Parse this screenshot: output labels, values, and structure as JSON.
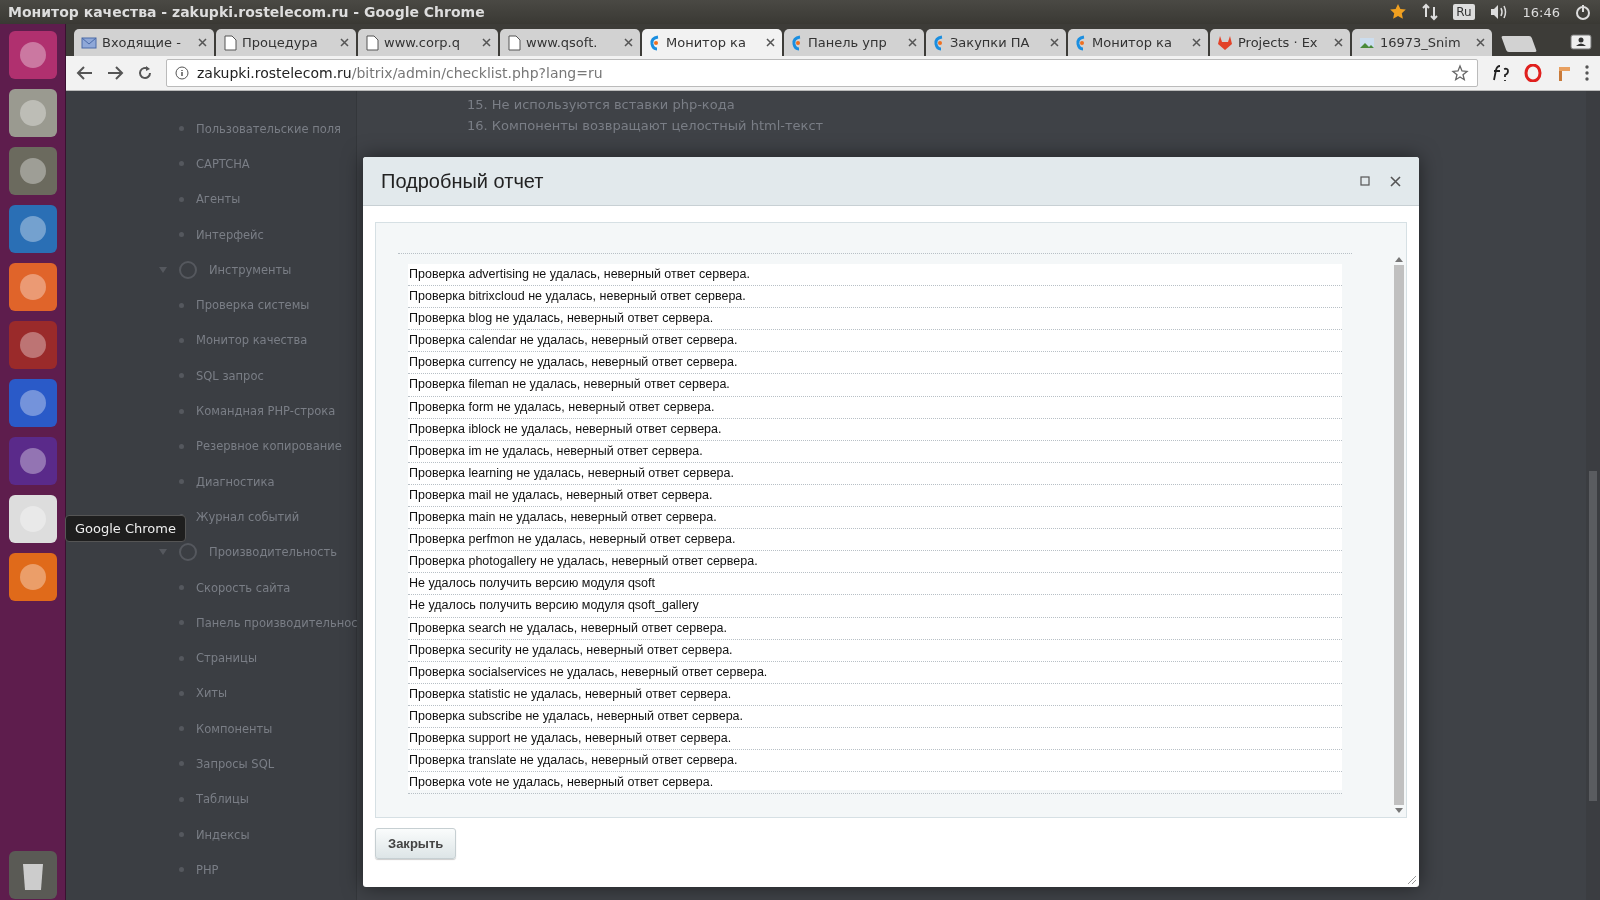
{
  "top_bar": {
    "title": "Монитор качества - zakupki.rostelecom.ru - Google Chrome",
    "keyboard": "Ru",
    "time": "16:46"
  },
  "tooltip": "Google Chrome",
  "tabs": [
    {
      "label": "Входящие -",
      "kind": "mail",
      "selected": false
    },
    {
      "label": "Процедура",
      "kind": "page",
      "selected": false
    },
    {
      "label": "www.corp.q",
      "kind": "page",
      "selected": false
    },
    {
      "label": "www.qsoft.",
      "kind": "page",
      "selected": false
    },
    {
      "label": "Монитор ка",
      "kind": "logo",
      "selected": true
    },
    {
      "label": "Панель упр",
      "kind": "logo",
      "selected": false
    },
    {
      "label": "Закупки ПА",
      "kind": "logo",
      "selected": false
    },
    {
      "label": "Монитор ка",
      "kind": "logo",
      "selected": false
    },
    {
      "label": "Projects · Ex",
      "kind": "fox",
      "selected": false
    },
    {
      "label": "16973_Snim",
      "kind": "image",
      "selected": false
    }
  ],
  "address": {
    "host": "zakupki.rostelecom.ru",
    "path": "/bitrix/admin/checklist.php?lang=ru"
  },
  "background_menu": [
    {
      "label": "Пользовательские поля",
      "kind": "item"
    },
    {
      "label": "CAPTCHA",
      "kind": "item"
    },
    {
      "label": "Агенты",
      "kind": "item"
    },
    {
      "label": "Интерфейс",
      "kind": "item"
    },
    {
      "label": "Инструменты",
      "kind": "section"
    },
    {
      "label": "Проверка системы",
      "kind": "item"
    },
    {
      "label": "Монитор качества",
      "kind": "item"
    },
    {
      "label": "SQL запрос",
      "kind": "item"
    },
    {
      "label": "Командная PHP-строка",
      "kind": "item"
    },
    {
      "label": "Резервное копирование",
      "kind": "item"
    },
    {
      "label": "Диагностика",
      "kind": "item"
    },
    {
      "label": "Журнал событий",
      "kind": "item"
    },
    {
      "label": "Производительность",
      "kind": "section"
    },
    {
      "label": "Скорость сайта",
      "kind": "item"
    },
    {
      "label": "Панель производительнос",
      "kind": "item"
    },
    {
      "label": "Страницы",
      "kind": "item"
    },
    {
      "label": "Хиты",
      "kind": "item"
    },
    {
      "label": "Компоненты",
      "kind": "item"
    },
    {
      "label": "Запросы SQL",
      "kind": "item"
    },
    {
      "label": "Таблицы",
      "kind": "item"
    },
    {
      "label": "Индексы",
      "kind": "item"
    },
    {
      "label": "PHP",
      "kind": "item"
    }
  ],
  "background_list": [
    "15. Не используются вставки php-кода",
    "16. Компоненты возвращают целостный html-текст"
  ],
  "dialog": {
    "title": "Подробный отчет",
    "close_button": "Закрыть",
    "lines": [
      "Проверка advertising не удалась, неверный ответ сервера.",
      "Проверка bitrixcloud не удалась, неверный ответ сервера.",
      "Проверка blog не удалась, неверный ответ сервера.",
      "Проверка calendar не удалась, неверный ответ сервера.",
      "Проверка currency не удалась, неверный ответ сервера.",
      "Проверка fileman не удалась, неверный ответ сервера.",
      "Проверка form не удалась, неверный ответ сервера.",
      "Проверка iblock не удалась, неверный ответ сервера.",
      "Проверка im не удалась, неверный ответ сервера.",
      "Проверка learning не удалась, неверный ответ сервера.",
      "Проверка mail не удалась, неверный ответ сервера.",
      "Проверка main не удалась, неверный ответ сервера.",
      "Проверка perfmon не удалась, неверный ответ сервера.",
      "Проверка photogallery не удалась, неверный ответ сервера.",
      "Не удалось получить версию модуля qsoft",
      "Не удалось получить версию модуля qsoft_gallery",
      "Проверка search не удалась, неверный ответ сервера.",
      "Проверка security не удалась, неверный ответ сервера.",
      "Проверка socialservices не удалась, неверный ответ сервера.",
      "Проверка statistic не удалась, неверный ответ сервера.",
      "Проверка subscribe не удалась, неверный ответ сервера.",
      "Проверка support не удалась, неверный ответ сервера.",
      "Проверка translate не удалась, неверный ответ сервера.",
      "Проверка vote не удалась, неверный ответ сервера."
    ]
  }
}
